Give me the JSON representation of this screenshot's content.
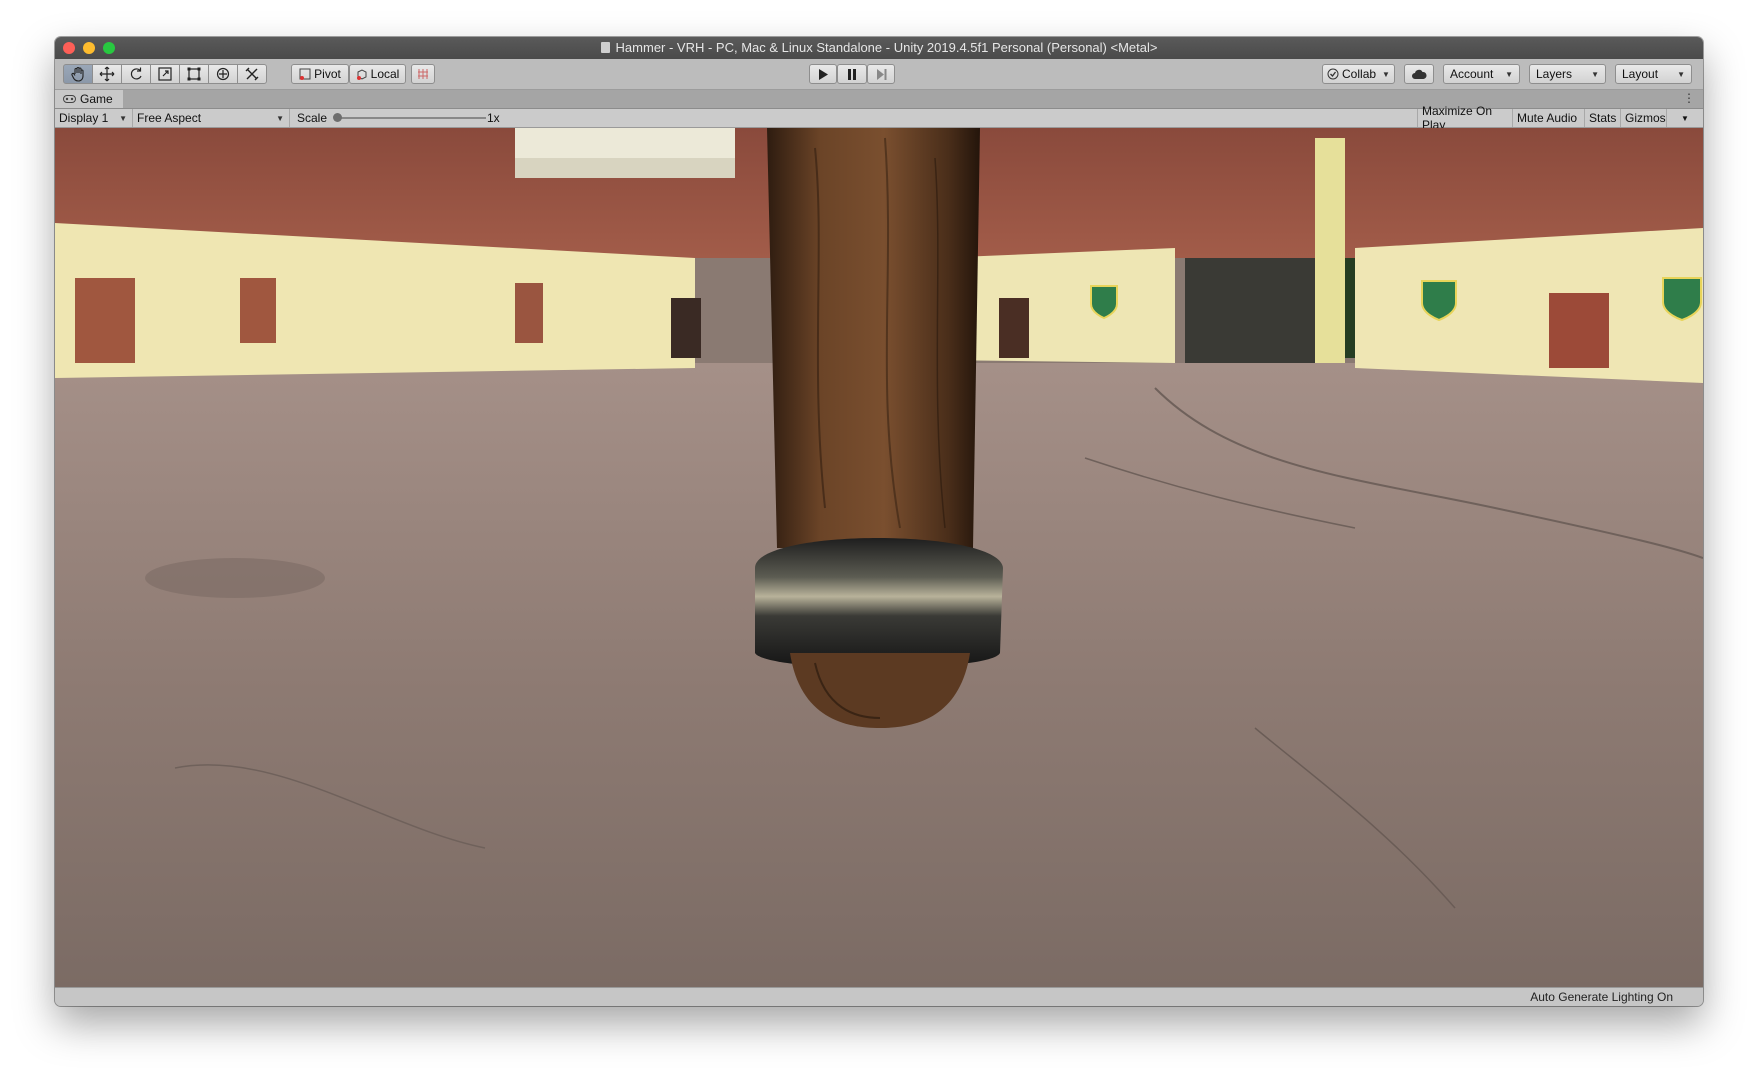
{
  "window": {
    "title": "Hammer - VRH - PC, Mac & Linux Standalone - Unity 2019.4.5f1 Personal (Personal) <Metal>"
  },
  "toolbar": {
    "tools": [
      "hand-tool",
      "move-tool",
      "rotate-tool",
      "scale-tool",
      "rect-tool",
      "transform-tool",
      "custom-tool"
    ],
    "pivot_label": "Pivot",
    "local_label": "Local",
    "collab_label": "Collab",
    "account_label": "Account",
    "layers_label": "Layers",
    "layout_label": "Layout"
  },
  "tab": {
    "label": "Game"
  },
  "gamebar": {
    "display": "Display 1",
    "aspect": "Free Aspect",
    "scale_label": "Scale",
    "scale_value": "1x",
    "maximize": "Maximize On Play",
    "mute": "Mute Audio",
    "stats": "Stats",
    "gizmos": "Gizmos"
  },
  "status": {
    "text": "Auto Generate Lighting On"
  },
  "colors": {
    "titlebar": "#4f4f4f",
    "toolbar": "#bcbcbc",
    "wall": "#efe6b0",
    "brick": "#9c4c3e",
    "ground": "#8a7a72",
    "wood": "#5a3a24",
    "metal": "#3a3a3a"
  }
}
